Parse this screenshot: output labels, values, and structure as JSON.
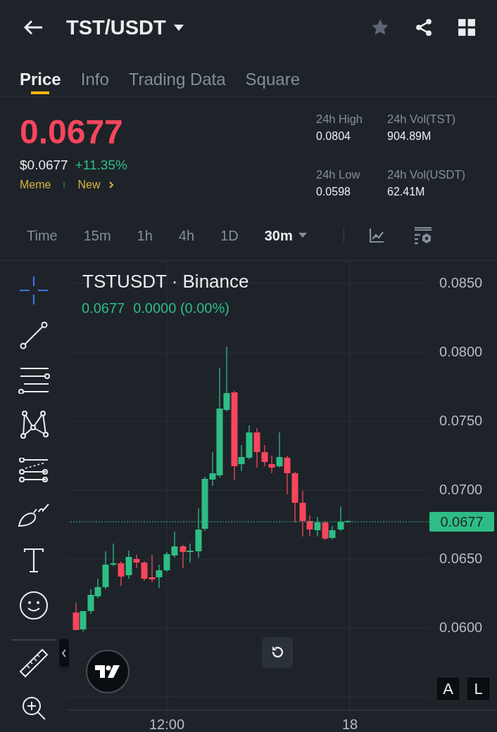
{
  "header": {
    "title": "TST/USDT"
  },
  "tabs": [
    {
      "label": "Price",
      "selected": true
    },
    {
      "label": "Info",
      "selected": false
    },
    {
      "label": "Trading Data",
      "selected": false
    },
    {
      "label": "Square",
      "selected": false
    }
  ],
  "price": {
    "last": "0.0677",
    "usd": "$0.0677",
    "change": "+11.35%",
    "tags": [
      "Meme",
      "New"
    ]
  },
  "stats": [
    {
      "label": "24h High",
      "value": "0.0804"
    },
    {
      "label": "24h Vol(TST)",
      "value": "904.89M"
    },
    {
      "label": "24h Low",
      "value": "0.0598"
    },
    {
      "label": "24h Vol(USDT)",
      "value": "62.41M"
    }
  ],
  "intervals": [
    {
      "label": "Time",
      "selected": false
    },
    {
      "label": "15m",
      "selected": false
    },
    {
      "label": "1h",
      "selected": false
    },
    {
      "label": "4h",
      "selected": false
    },
    {
      "label": "1D",
      "selected": false
    },
    {
      "label": "30m",
      "selected": true
    }
  ],
  "chart": {
    "symbol": "TSTUSDT · Binance",
    "last": "0.0677",
    "change": "0.0000 (0.00%)",
    "price_scale": [
      "0.0850",
      "0.0800",
      "0.0750",
      "0.0700",
      "0.0650",
      "0.0600"
    ],
    "current_price": "0.0677",
    "time_labels": [
      "12:00",
      "18"
    ],
    "scale_buttons": [
      "A",
      "L"
    ]
  }
}
